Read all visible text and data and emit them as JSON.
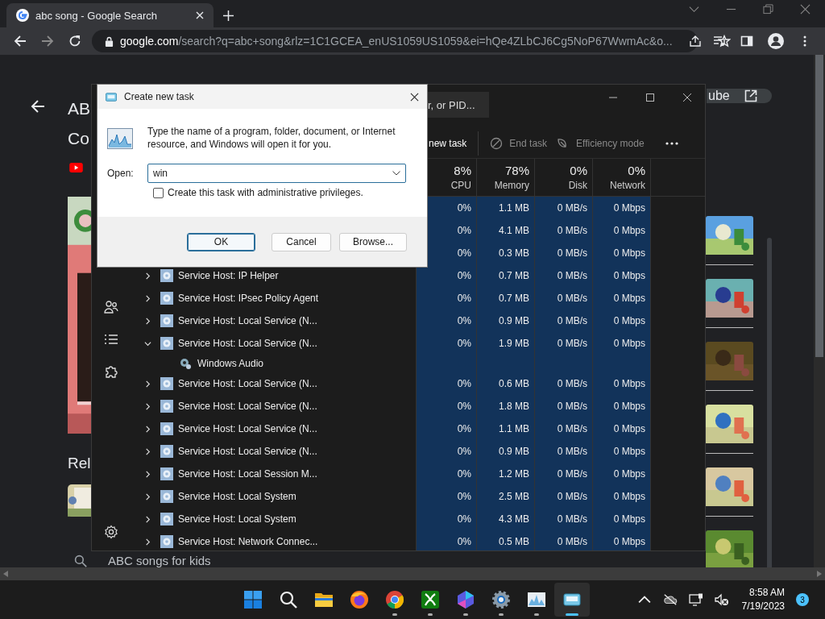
{
  "browser": {
    "tab": {
      "title": "abc song - Google Search"
    },
    "url": {
      "host": "google.com",
      "path": "/search?q=abc+song&rlz=1C1GCEA_enUS1059US1059&ei=hQe4ZLbCJ6Cg5NoP67WwmAc&o..."
    }
  },
  "page": {
    "title_lines": [
      "AB",
      "Co"
    ],
    "open_button": "ube",
    "related_heading": "Rel",
    "search_suggestion": "ABC songs for kids"
  },
  "task_manager": {
    "search_placeholder": "r, or PID...",
    "commands": [
      {
        "kind": "run",
        "label": "new task",
        "disabled": false
      },
      {
        "kind": "end",
        "label": "End task",
        "disabled": true
      },
      {
        "kind": "efficiency",
        "label": "Efficiency mode",
        "disabled": true
      }
    ],
    "columns": [
      {
        "percent": "8%",
        "label": "CPU"
      },
      {
        "percent": "78%",
        "label": "Memory"
      },
      {
        "percent": "0%",
        "label": "Disk"
      },
      {
        "percent": "0%",
        "label": "Network"
      }
    ],
    "rows": [
      {
        "values": [
          "0%",
          "1.1 MB",
          "0 MB/s",
          "0 Mbps"
        ]
      },
      {
        "values": [
          "0%",
          "4.1 MB",
          "0 MB/s",
          "0 Mbps"
        ]
      },
      {
        "values": [
          "0%",
          "0.3 MB",
          "0 MB/s",
          "0 Mbps"
        ]
      },
      {
        "name": "Service Host: IP Helper",
        "expanded": false,
        "values": [
          "0%",
          "0.7 MB",
          "0 MB/s",
          "0 Mbps"
        ]
      },
      {
        "name": "Service Host: IPsec Policy Agent",
        "expanded": false,
        "values": [
          "0%",
          "0.7 MB",
          "0 MB/s",
          "0 Mbps"
        ]
      },
      {
        "name": "Service Host: Local Service (N...",
        "expanded": false,
        "values": [
          "0%",
          "0.9 MB",
          "0 MB/s",
          "0 Mbps"
        ]
      },
      {
        "name": "Service Host: Local Service (N...",
        "expanded": true,
        "values": [
          "0%",
          "1.9 MB",
          "0 MB/s",
          "0 Mbps"
        ],
        "children": [
          {
            "name": "Windows Audio"
          }
        ]
      },
      {
        "name": "Service Host: Local Service (N...",
        "expanded": false,
        "values": [
          "0%",
          "0.6 MB",
          "0 MB/s",
          "0 Mbps"
        ]
      },
      {
        "name": "Service Host: Local Service (N...",
        "expanded": false,
        "values": [
          "0%",
          "1.8 MB",
          "0 MB/s",
          "0 Mbps"
        ]
      },
      {
        "name": "Service Host: Local Service (N...",
        "expanded": false,
        "values": [
          "0%",
          "1.1 MB",
          "0 MB/s",
          "0 Mbps"
        ]
      },
      {
        "name": "Service Host: Local Service (N...",
        "expanded": false,
        "values": [
          "0%",
          "0.9 MB",
          "0 MB/s",
          "0 Mbps"
        ]
      },
      {
        "name": "Service Host: Local Session M...",
        "expanded": false,
        "values": [
          "0%",
          "1.2 MB",
          "0 MB/s",
          "0 Mbps"
        ]
      },
      {
        "name": "Service Host: Local System",
        "expanded": false,
        "values": [
          "0%",
          "2.5 MB",
          "0 MB/s",
          "0 Mbps"
        ]
      },
      {
        "name": "Service Host: Local System",
        "expanded": false,
        "values": [
          "0%",
          "4.3 MB",
          "0 MB/s",
          "0 Mbps"
        ]
      },
      {
        "name": "Service Host: Network Connec...",
        "expanded": false,
        "values": [
          "0%",
          "0.5 MB",
          "0 MB/s",
          "0 Mbps"
        ]
      }
    ]
  },
  "dialog": {
    "title": "Create new task",
    "message": "Type the name of a program, folder, document, or Internet resource, and Windows will open it for you.",
    "open_label": "Open:",
    "value": "win",
    "admin_checkbox": {
      "label": "Create this task with administrative privileges.",
      "checked": false
    },
    "buttons": [
      {
        "label": "OK",
        "default": true
      },
      {
        "label": "Cancel",
        "default": false
      },
      {
        "label": "Browse...",
        "default": false
      }
    ]
  },
  "taskbar": {
    "apps": [
      {
        "kind": "start",
        "running": false,
        "active": false
      },
      {
        "kind": "search",
        "running": false,
        "active": false
      },
      {
        "kind": "folder",
        "running": false,
        "active": false
      },
      {
        "kind": "firefox",
        "running": false,
        "active": false
      },
      {
        "kind": "chrome",
        "running": true,
        "active": false
      },
      {
        "kind": "xbox",
        "running": true,
        "active": false
      },
      {
        "kind": "copilot",
        "running": true,
        "active": false
      },
      {
        "kind": "settings",
        "running": true,
        "active": false
      },
      {
        "kind": "taskmgr",
        "running": true,
        "active": false
      },
      {
        "kind": "run",
        "running": true,
        "active": true
      }
    ],
    "clock": {
      "time": "8:58 AM",
      "date": "7/19/2023"
    },
    "notification_count": "3"
  }
}
